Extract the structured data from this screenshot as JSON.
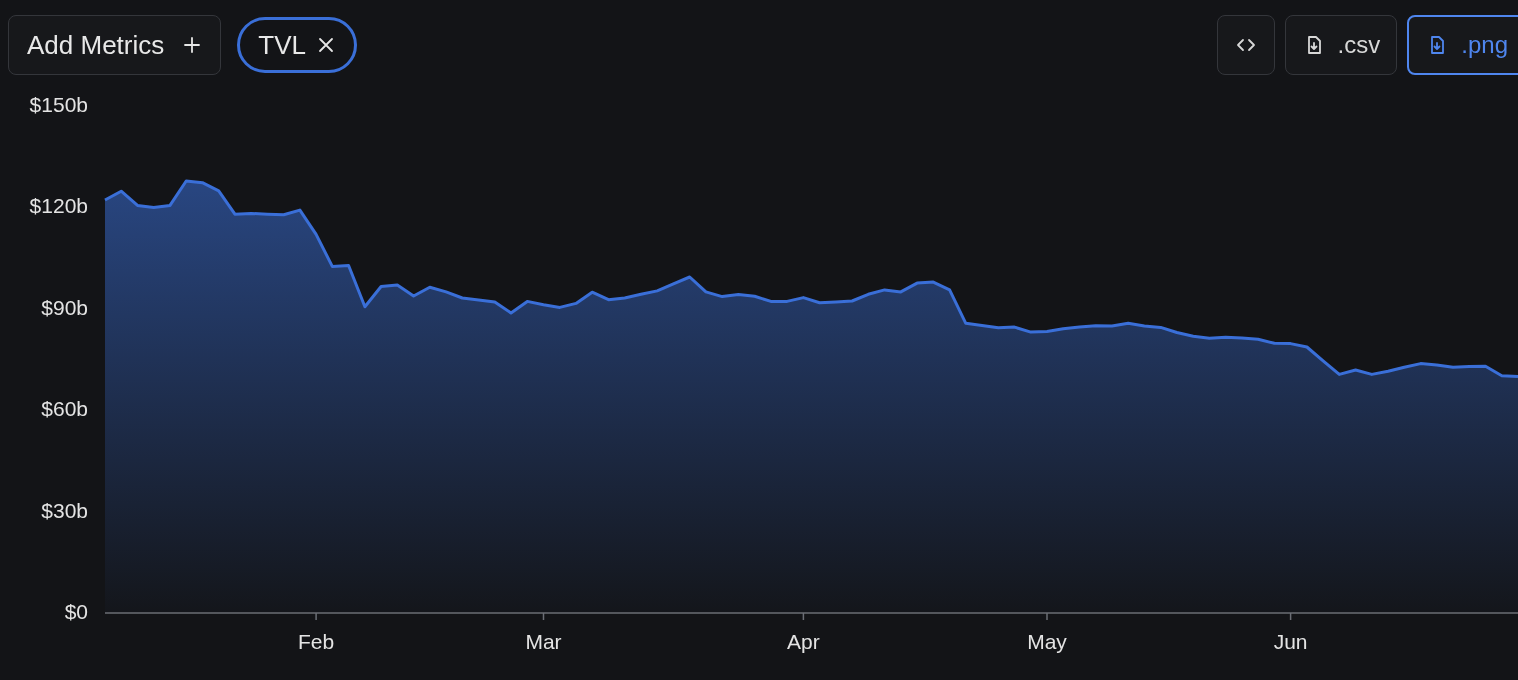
{
  "toolbar": {
    "add_metrics": {
      "label": "Add Metrics"
    },
    "buttons": [
      {
        "kind": "code",
        "selected": false
      },
      {
        "kind": "download",
        "label": ".csv",
        "selected": false
      },
      {
        "kind": "download",
        "label": ".png",
        "selected": true
      }
    ]
  },
  "chart": {
    "chart_data": {
      "type": "area",
      "categories": [
        null,
        null,
        null,
        null,
        null,
        null,
        null,
        null,
        null,
        null,
        null,
        null,
        null,
        "Feb",
        null,
        null,
        null,
        null,
        null,
        null,
        null,
        null,
        null,
        null,
        null,
        null,
        null,
        "Mar",
        null,
        null,
        null,
        null,
        null,
        null,
        null,
        null,
        null,
        null,
        null,
        null,
        null,
        null,
        null,
        "Apr",
        null,
        null,
        null,
        null,
        null,
        null,
        null,
        null,
        null,
        null,
        null,
        null,
        null,
        null,
        "May",
        null,
        null,
        null,
        null,
        null,
        null,
        null,
        null,
        null,
        null,
        null,
        null,
        null,
        null,
        "Jun",
        null,
        null,
        null,
        null,
        null,
        null,
        null,
        null,
        null,
        null,
        null,
        null,
        null,
        null
      ],
      "series": [
        {
          "name": "TVL",
          "color": "#3a6fd8",
          "values": [
            122.2,
            124.8,
            120.6,
            120,
            120.6,
            127.8,
            127.3,
            124.9,
            118,
            118.2,
            118,
            117.8,
            119.2,
            112,
            102.5,
            102.8,
            90.6,
            96.6,
            97,
            93.8,
            96.4,
            95,
            93.2,
            92.6,
            92,
            88.8,
            92.2,
            91.2,
            90.4,
            91.6,
            94.9,
            92.7,
            93.2,
            94.3,
            95.3,
            97.4,
            99.4,
            95,
            93.6,
            94.2,
            93.7,
            92.2,
            92.2,
            93.3,
            91.8,
            92,
            92.3,
            94.3,
            95.6,
            95,
            97.6,
            97.9,
            95.6,
            85.7,
            85.1,
            84.4,
            84.6,
            83.1,
            83.3,
            84.1,
            84.6,
            85,
            84.9,
            85.7,
            84.9,
            84.5,
            83,
            81.9,
            81.3,
            81.6,
            81.4,
            81,
            79.8,
            79.7,
            78.7,
            74.6,
            70.6,
            71.9,
            70.6,
            71.5,
            72.7,
            73.8,
            73.4,
            72.7,
            72.9,
            73,
            70.2,
            70
          ]
        }
      ],
      "ylim": [
        0,
        150
      ],
      "yticks": [
        {
          "value": 0,
          "label": "$0"
        },
        {
          "value": 30,
          "label": "$30b"
        },
        {
          "value": 60,
          "label": "$60b"
        },
        {
          "value": 90,
          "label": "$90b"
        },
        {
          "value": 120,
          "label": "$120b"
        },
        {
          "value": 150,
          "label": "$150b"
        }
      ]
    }
  }
}
